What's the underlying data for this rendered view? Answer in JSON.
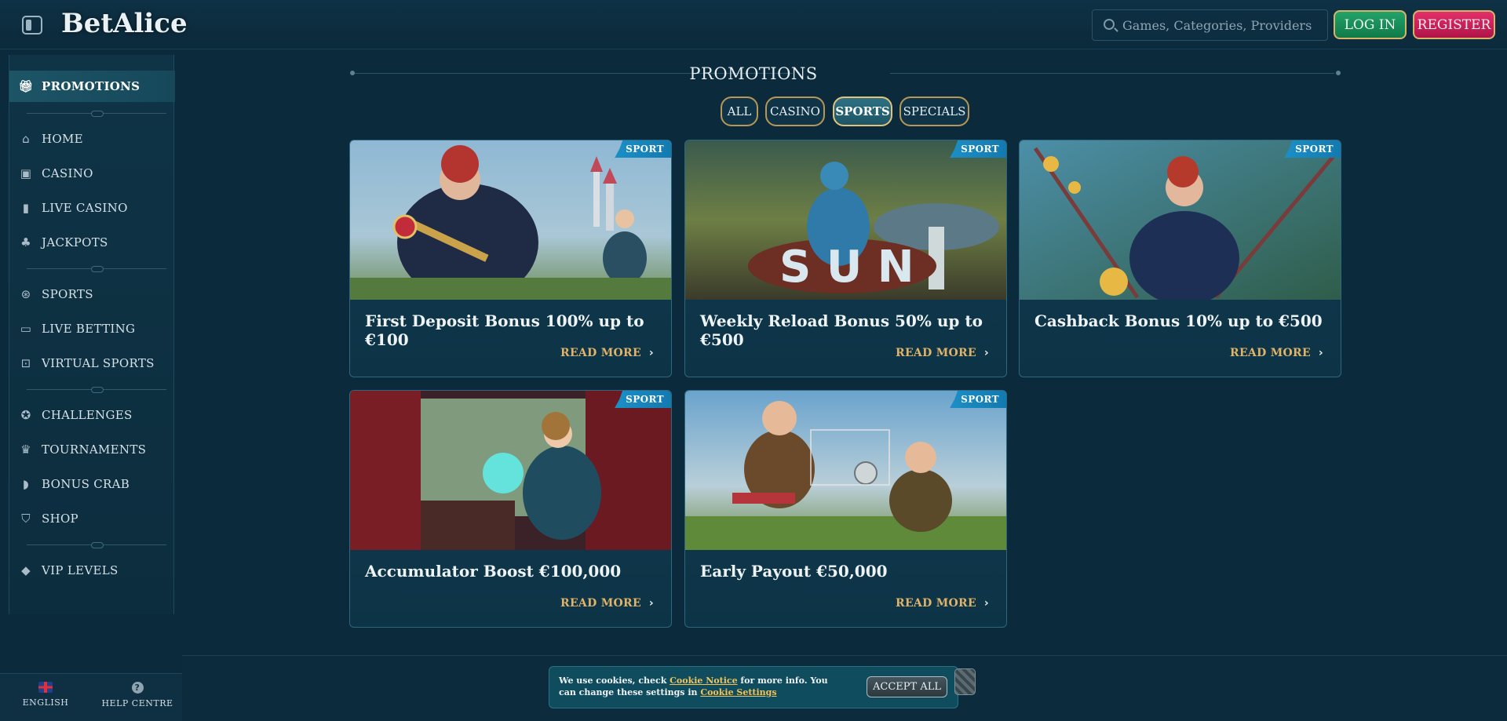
{
  "header": {
    "logo": "BetAlice",
    "search_placeholder": "Games, Categories, Providers",
    "login_label": "LOG IN",
    "register_label": "REGISTER"
  },
  "sidebar": {
    "items": [
      {
        "label": "PROMOTIONS",
        "icon": "gift-icon",
        "active": true
      },
      {
        "label": "HOME",
        "icon": "home-icon"
      },
      {
        "label": "CASINO",
        "icon": "slot-machine-icon"
      },
      {
        "label": "LIVE CASINO",
        "icon": "card-icon"
      },
      {
        "label": "JACKPOTS",
        "icon": "clover-icon"
      },
      {
        "label": "SPORTS",
        "icon": "ball-icon"
      },
      {
        "label": "LIVE BETTING",
        "icon": "live-icon"
      },
      {
        "label": "VIRTUAL SPORTS",
        "icon": "virtual-icon"
      },
      {
        "label": "CHALLENGES",
        "icon": "medal-icon"
      },
      {
        "label": "TOURNAMENTS",
        "icon": "trophy-icon"
      },
      {
        "label": "BONUS CRAB",
        "icon": "crab-icon"
      },
      {
        "label": "SHOP",
        "icon": "shop-bag-icon"
      },
      {
        "label": "VIP LEVELS",
        "icon": "diamond-icon"
      }
    ]
  },
  "footer_left": {
    "language_label": "ENGLISH",
    "help_label": "HELP CENTRE"
  },
  "main": {
    "title": "PROMOTIONS",
    "tabs": [
      {
        "label": "ALL"
      },
      {
        "label": "CASINO"
      },
      {
        "label": "SPORTS",
        "active": true
      },
      {
        "label": "SPECIALS"
      }
    ],
    "cards": [
      {
        "badge": "SPORT",
        "title": "First Deposit Bonus 100% up to €100",
        "read_more": "READ MORE"
      },
      {
        "badge": "SPORT",
        "title": "Weekly Reload Bonus 50% up to €500",
        "read_more": "READ MORE"
      },
      {
        "badge": "SPORT",
        "title": "Cashback Bonus 10% up to €500",
        "read_more": "READ MORE"
      },
      {
        "badge": "SPORT",
        "title": "Accumulator Boost €100,000",
        "read_more": "READ MORE"
      },
      {
        "badge": "SPORT",
        "title": "Early Payout €50,000",
        "read_more": "READ MORE"
      }
    ]
  },
  "cookie": {
    "text_1": "We use cookies, check ",
    "link_1": "Cookie Notice",
    "text_2": " for more info. You can change these settings in ",
    "link_2": "Cookie Settings",
    "accept_label": "ACCEPT ALL"
  },
  "colors": {
    "background": "#0b2a3b",
    "accent_gold": "#e0b36a",
    "login_green": "#22a36a",
    "register_pink": "#e2306a",
    "badge_blue": "#1b8fc6"
  }
}
